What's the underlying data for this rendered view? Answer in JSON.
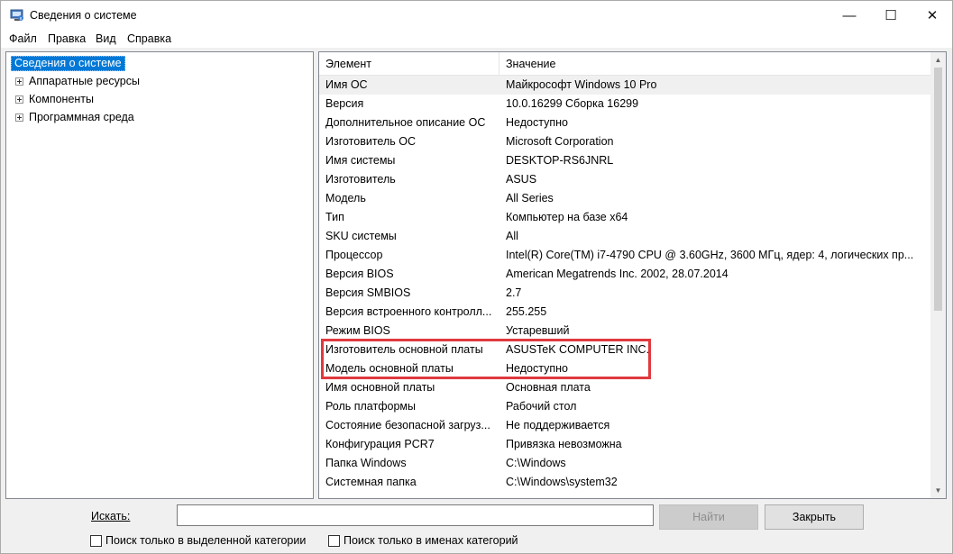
{
  "window": {
    "title": "Сведения о системе",
    "minimize": "—",
    "maximize": "☐",
    "close": "✕"
  },
  "menu": [
    "Файл",
    "Правка",
    "Вид",
    "Справка"
  ],
  "tree": {
    "root": "Сведения о системе",
    "children": [
      "Аппаратные ресурсы",
      "Компоненты",
      "Программная среда"
    ]
  },
  "list": {
    "columns": [
      "Элемент",
      "Значение"
    ],
    "rows": [
      [
        "Имя ОС",
        "Майкрософт Windows 10 Pro"
      ],
      [
        "Версия",
        "10.0.16299 Сборка 16299"
      ],
      [
        "Дополнительное описание ОС",
        "Недоступно"
      ],
      [
        "Изготовитель ОС",
        "Microsoft Corporation"
      ],
      [
        "Имя системы",
        "DESKTOP-RS6JNRL"
      ],
      [
        "Изготовитель",
        "ASUS"
      ],
      [
        "Модель",
        "All Series"
      ],
      [
        "Тип",
        "Компьютер на базе x64"
      ],
      [
        "SKU системы",
        "All"
      ],
      [
        "Процессор",
        "Intel(R) Core(TM) i7-4790 CPU @ 3.60GHz, 3600 МГц, ядер: 4, логических пр..."
      ],
      [
        "Версия BIOS",
        "American Megatrends Inc. 2002, 28.07.2014"
      ],
      [
        "Версия SMBIOS",
        "2.7"
      ],
      [
        "Версия встроенного контролл...",
        "255.255"
      ],
      [
        "Режим BIOS",
        "Устаревший"
      ],
      [
        "Изготовитель основной платы",
        "ASUSTeK COMPUTER INC."
      ],
      [
        "Модель основной платы",
        "Недоступно"
      ],
      [
        "Имя основной платы",
        "Основная плата"
      ],
      [
        "Роль платформы",
        "Рабочий стол"
      ],
      [
        "Состояние безопасной загруз...",
        "Не поддерживается"
      ],
      [
        "Конфигурация PCR7",
        "Привязка невозможна"
      ],
      [
        "Папка Windows",
        "C:\\Windows"
      ],
      [
        "Системная папка",
        "C:\\Windows\\system32"
      ]
    ]
  },
  "search": {
    "label": "Искать:",
    "value": "",
    "find_button": "Найти",
    "close_button": "Закрыть",
    "check_selected": "Поиск только в выделенной категории",
    "check_names": "Поиск только в именах категорий"
  },
  "colors": {
    "selection": "#0078d7",
    "highlight_box": "#e0393e"
  }
}
